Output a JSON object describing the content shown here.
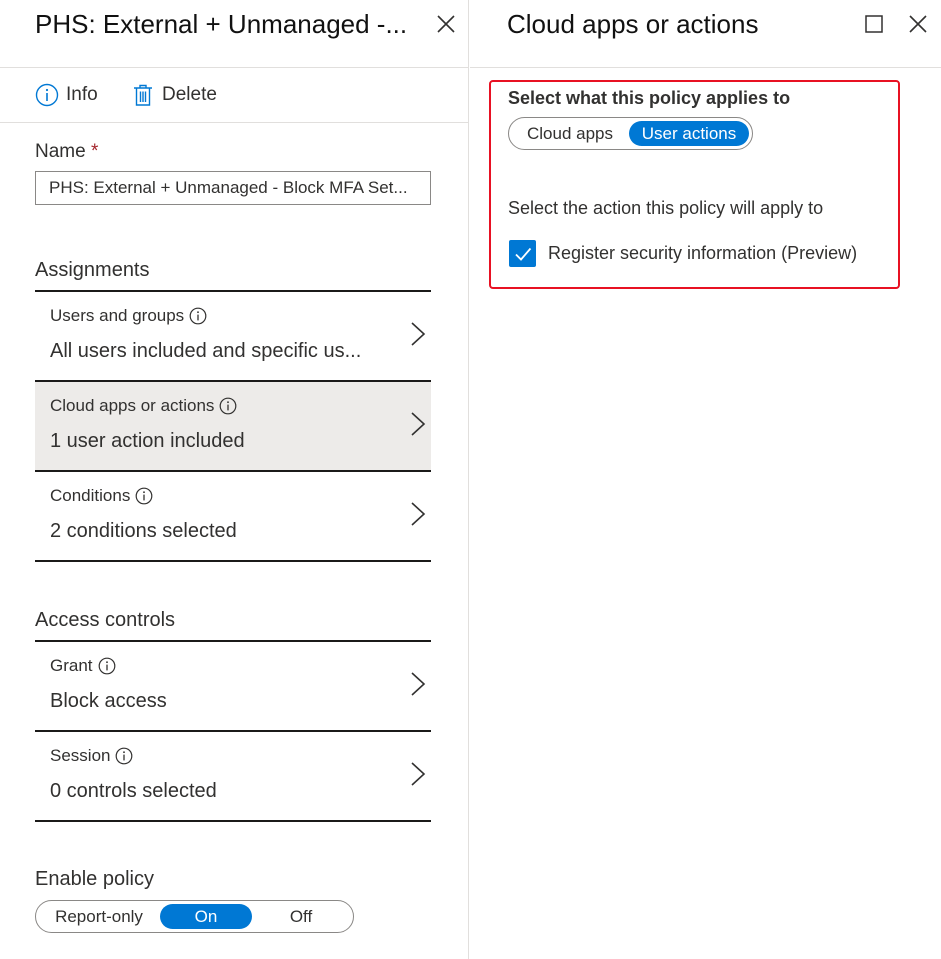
{
  "left_blade": {
    "title": "PHS: External + Unmanaged -...",
    "commands": {
      "info": "Info",
      "delete": "Delete"
    },
    "name_label": "Name",
    "name_required": "*",
    "name_value": "PHS: External + Unmanaged - Block MFA Set...",
    "assignments_title": "Assignments",
    "assignments": [
      {
        "title": "Users and groups",
        "value": "All users included and specific us..."
      },
      {
        "title": "Cloud apps or actions",
        "value": "1 user action included",
        "selected": true
      },
      {
        "title": "Conditions",
        "value": "2 conditions selected"
      }
    ],
    "access_controls_title": "Access controls",
    "access_controls": [
      {
        "title": "Grant",
        "value": "Block access"
      },
      {
        "title": "Session",
        "value": "0 controls selected"
      }
    ],
    "enable_policy_label": "Enable policy",
    "enable_policy_options": [
      "Report-only",
      "On",
      "Off"
    ],
    "enable_policy_selected": "On"
  },
  "right_blade": {
    "title": "Cloud apps or actions",
    "applies_to_label": "Select what this policy applies to",
    "applies_to_options": [
      "Cloud apps",
      "User actions"
    ],
    "applies_to_selected": "User actions",
    "action_label": "Select the action this policy will apply to",
    "action_checkbox_label": "Register security information (Preview)",
    "action_checked": true
  },
  "colors": {
    "accent": "#0078d4",
    "highlight_border": "#e81123",
    "selected_row_bg": "#edebe9",
    "required": "#a4262c"
  },
  "icons": [
    "close-icon",
    "maximize-icon",
    "info-icon",
    "delete-icon",
    "chevron-right-icon",
    "checkmark-icon"
  ]
}
